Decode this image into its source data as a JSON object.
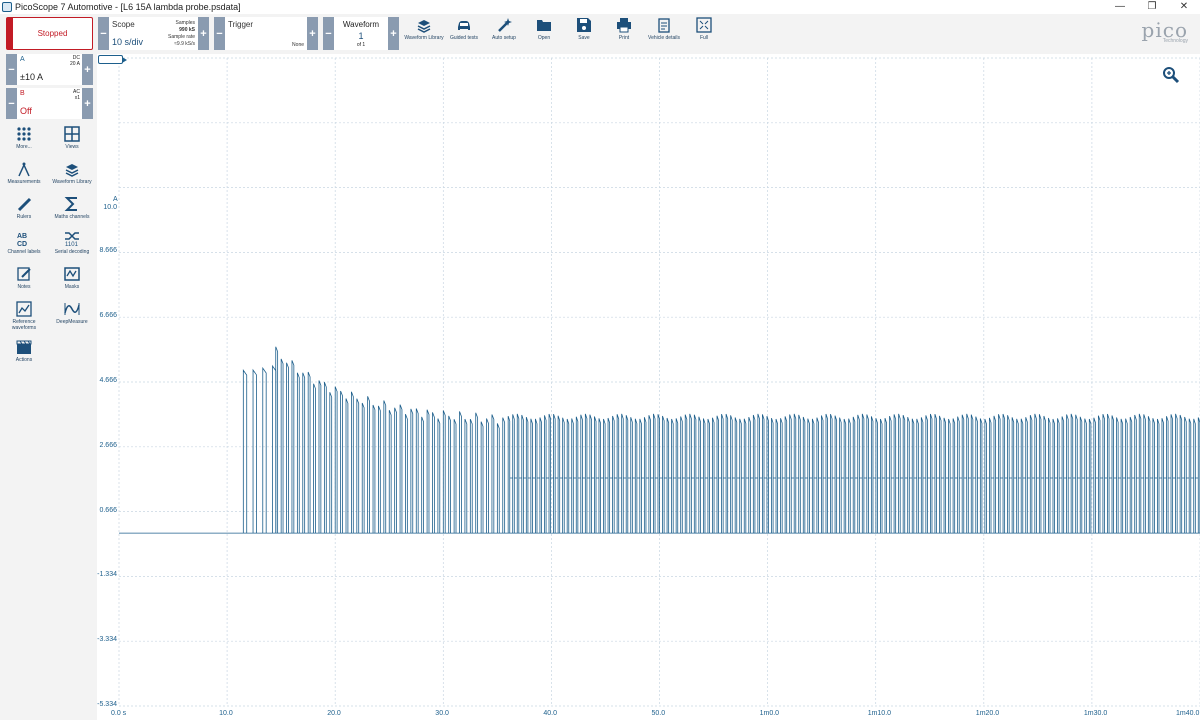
{
  "window": {
    "title": "PicoScope 7 Automotive - [L6 15A lambda probe.psdata]"
  },
  "toolbar": {
    "run_state": "Stopped",
    "scope": {
      "title": "Scope",
      "timebase": "10 s/div",
      "samples_label": "Samples",
      "samples_value": "990 kS",
      "rate_label": "Sample rate",
      "rate_value": "≈9.9 kS/s"
    },
    "trigger": {
      "title": "Trigger",
      "mode": "None"
    },
    "waveform": {
      "title": "Waveform",
      "index": "1",
      "count": "of 1"
    },
    "tools": [
      {
        "label": "Waveform Library",
        "icon": "waveform-library-icon"
      },
      {
        "label": "Guided tests",
        "icon": "car-icon"
      },
      {
        "label": "Auto setup",
        "icon": "wand-icon"
      },
      {
        "label": "Open",
        "icon": "folder-icon"
      },
      {
        "label": "Save",
        "icon": "save-icon"
      },
      {
        "label": "Print",
        "icon": "print-icon"
      },
      {
        "label": "Vehicle details",
        "icon": "clipboard-icon"
      },
      {
        "label": "Full",
        "icon": "fullscreen-icon"
      }
    ],
    "logo": {
      "word": "pico",
      "sub": "Technology"
    }
  },
  "channels": [
    {
      "name": "A",
      "coupling": "DC",
      "probe": "20 A",
      "range": "±10 A",
      "color": "#1d5f8c"
    },
    {
      "name": "B",
      "coupling": "AC",
      "probe": "x1",
      "range": "Off",
      "color": "#c21b25"
    }
  ],
  "sidebar_tools": [
    {
      "label": "More...",
      "icon": "grid-icon"
    },
    {
      "label": "Views",
      "icon": "views-icon"
    },
    {
      "label": "Measurements",
      "icon": "compass-icon"
    },
    {
      "label": "Waveform Library",
      "icon": "waveform-library-icon"
    },
    {
      "label": "Rulers",
      "icon": "ruler-icon"
    },
    {
      "label": "Maths channels",
      "icon": "sigma-icon"
    },
    {
      "label": "Channel labels",
      "icon": "abcd-icon"
    },
    {
      "label": "Serial decoding",
      "icon": "serial-icon"
    },
    {
      "label": "Notes",
      "icon": "notes-icon"
    },
    {
      "label": "Masks",
      "icon": "masks-icon"
    },
    {
      "label": "Reference waveforms",
      "icon": "reference-icon"
    },
    {
      "label": "DeepMeasure",
      "icon": "deepmeasure-icon"
    },
    {
      "label": "Actions",
      "icon": "actions-icon"
    }
  ],
  "chart_data": {
    "type": "line",
    "yunit": "A",
    "y_ticks": [
      "10.0",
      "8.666",
      "6.666",
      "4.666",
      "2.666",
      "0.666",
      "-1.334",
      "-3.334",
      "-5.334"
    ],
    "x_ticks": [
      "0.0 s",
      "10.0",
      "20.0",
      "30.0",
      "40.0",
      "50.0",
      "1m0.0",
      "1m10.0",
      "1m20.0",
      "1m30.0",
      "1m40.0"
    ],
    "ylim": [
      -5.334,
      10.0
    ],
    "xlim": [
      0,
      100
    ],
    "grid": true,
    "series_color": "#1d5f8c",
    "series": [
      {
        "name": "A",
        "segments": [
          {
            "t_start": 0,
            "t_end": 11.5,
            "baseline": 0.0,
            "pulses": false
          },
          {
            "t_start": 11.5,
            "t_end": 14.5,
            "baseline": 0.0,
            "pulse_peak": 5.1,
            "pulse_period": 0.9,
            "pulses": true
          },
          {
            "t_start": 14.5,
            "t_end": 36.0,
            "baseline": 0.0,
            "pulse_peak_start": 5.6,
            "pulse_peak_end": 3.4,
            "pulse_period": 0.5,
            "pulses": true
          },
          {
            "t_start": 36.0,
            "t_end": 100.0,
            "baseline": 0.0,
            "pulse_peak": 3.6,
            "mid_level": 1.7,
            "pulse_period": 0.42,
            "pulses": true
          }
        ]
      }
    ]
  }
}
